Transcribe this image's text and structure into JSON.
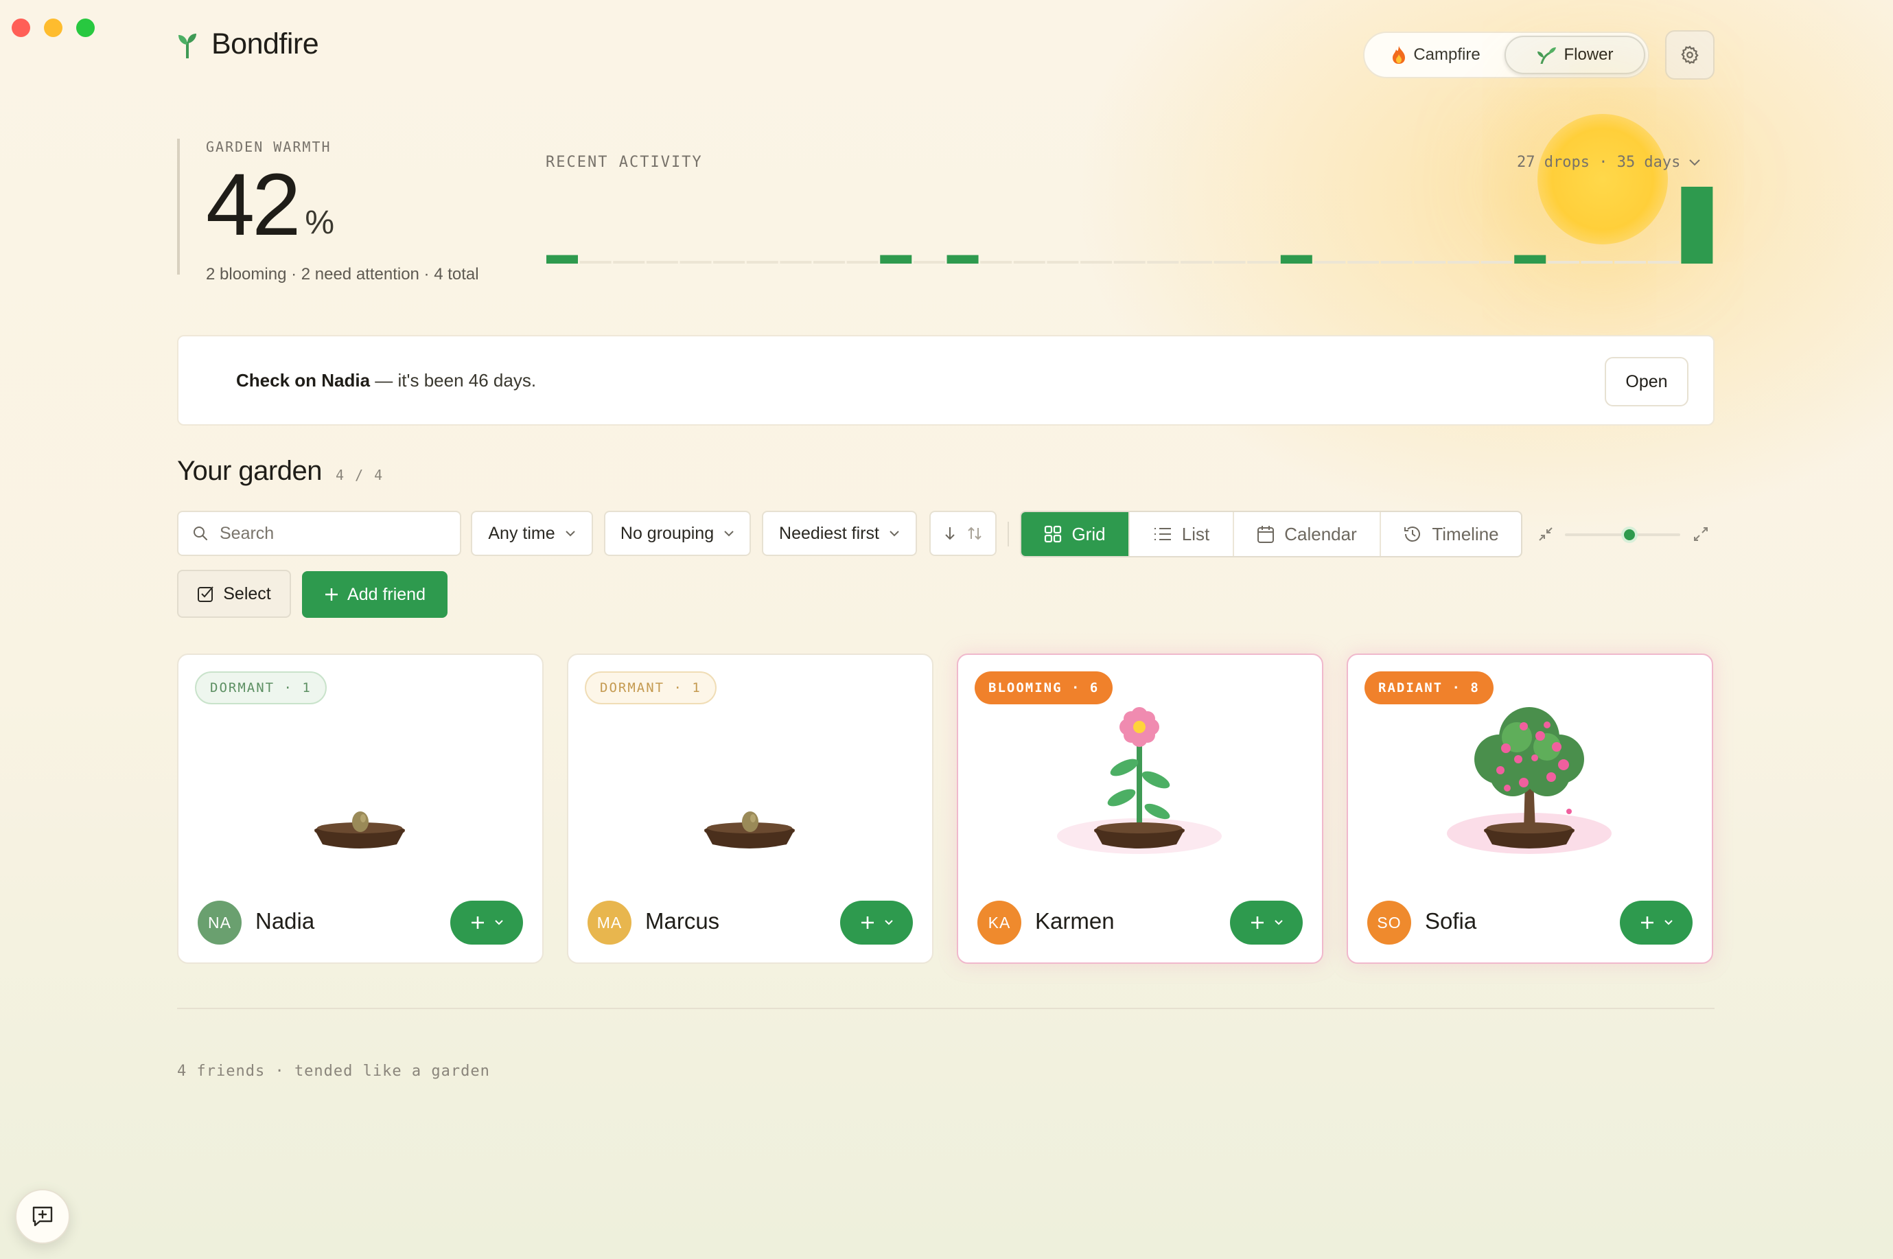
{
  "app": {
    "name": "Bondfire"
  },
  "modes": {
    "campfire": "Campfire",
    "flower": "Flower",
    "active": "Flower"
  },
  "stats": {
    "warmth_label": "GARDEN WARMTH",
    "warmth_value": "42",
    "warmth_unit": "%",
    "summary": "2 blooming · 2 need attention · 4 total",
    "activity_label": "RECENT ACTIVITY",
    "activity_range": "27 drops · 35 days"
  },
  "chart_data": {
    "type": "bar",
    "title": "RECENT ACTIVITY",
    "categories": [
      1,
      2,
      3,
      4,
      5,
      6,
      7,
      8,
      9,
      10,
      11,
      12,
      13,
      14,
      15,
      16,
      17,
      18,
      19,
      20,
      21,
      22,
      23,
      24,
      25,
      26,
      27,
      28,
      29,
      30,
      31,
      32,
      33,
      34,
      35
    ],
    "values": [
      1,
      0,
      0,
      0,
      0,
      0,
      0,
      0,
      0,
      0,
      1,
      0,
      1,
      0,
      0,
      0,
      0,
      0,
      0,
      0,
      0,
      0,
      1,
      0,
      0,
      0,
      0,
      0,
      0,
      1,
      0,
      0,
      0,
      0,
      9
    ],
    "ylim": [
      0,
      9
    ],
    "color": "#2e9a4e"
  },
  "banner": {
    "bold": "Check on Nadia",
    "rest": " — it's been 46 days.",
    "open_label": "Open"
  },
  "garden": {
    "title": "Your garden",
    "count": "4 / 4"
  },
  "toolbar": {
    "search_placeholder": "Search",
    "time_filter": "Any time",
    "grouping": "No grouping",
    "sort": "Neediest first",
    "views": {
      "grid": "Grid",
      "list": "List",
      "calendar": "Calendar",
      "timeline": "Timeline"
    },
    "zoom_level": 0.5,
    "select_label": "Select",
    "add_label": "Add friend"
  },
  "friends": [
    {
      "initials": "NA",
      "name": "Nadia",
      "stage": "DORMANT · 1",
      "avatar_color": "#6aa06f"
    },
    {
      "initials": "MA",
      "name": "Marcus",
      "stage": "DORMANT · 1",
      "avatar_color": "#e8b64e"
    },
    {
      "initials": "KA",
      "name": "Karmen",
      "stage": "BLOOMING · 6",
      "avatar_color": "#ef8a2d"
    },
    {
      "initials": "SO",
      "name": "Sofia",
      "stage": "RADIANT · 8",
      "avatar_color": "#ef8a2d"
    }
  ],
  "footer": {
    "text": "4 friends · tended like a garden"
  },
  "colors": {
    "accent": "#2e9a4e",
    "orange": "#f0812b",
    "pink_border": "#f0b8cc"
  }
}
